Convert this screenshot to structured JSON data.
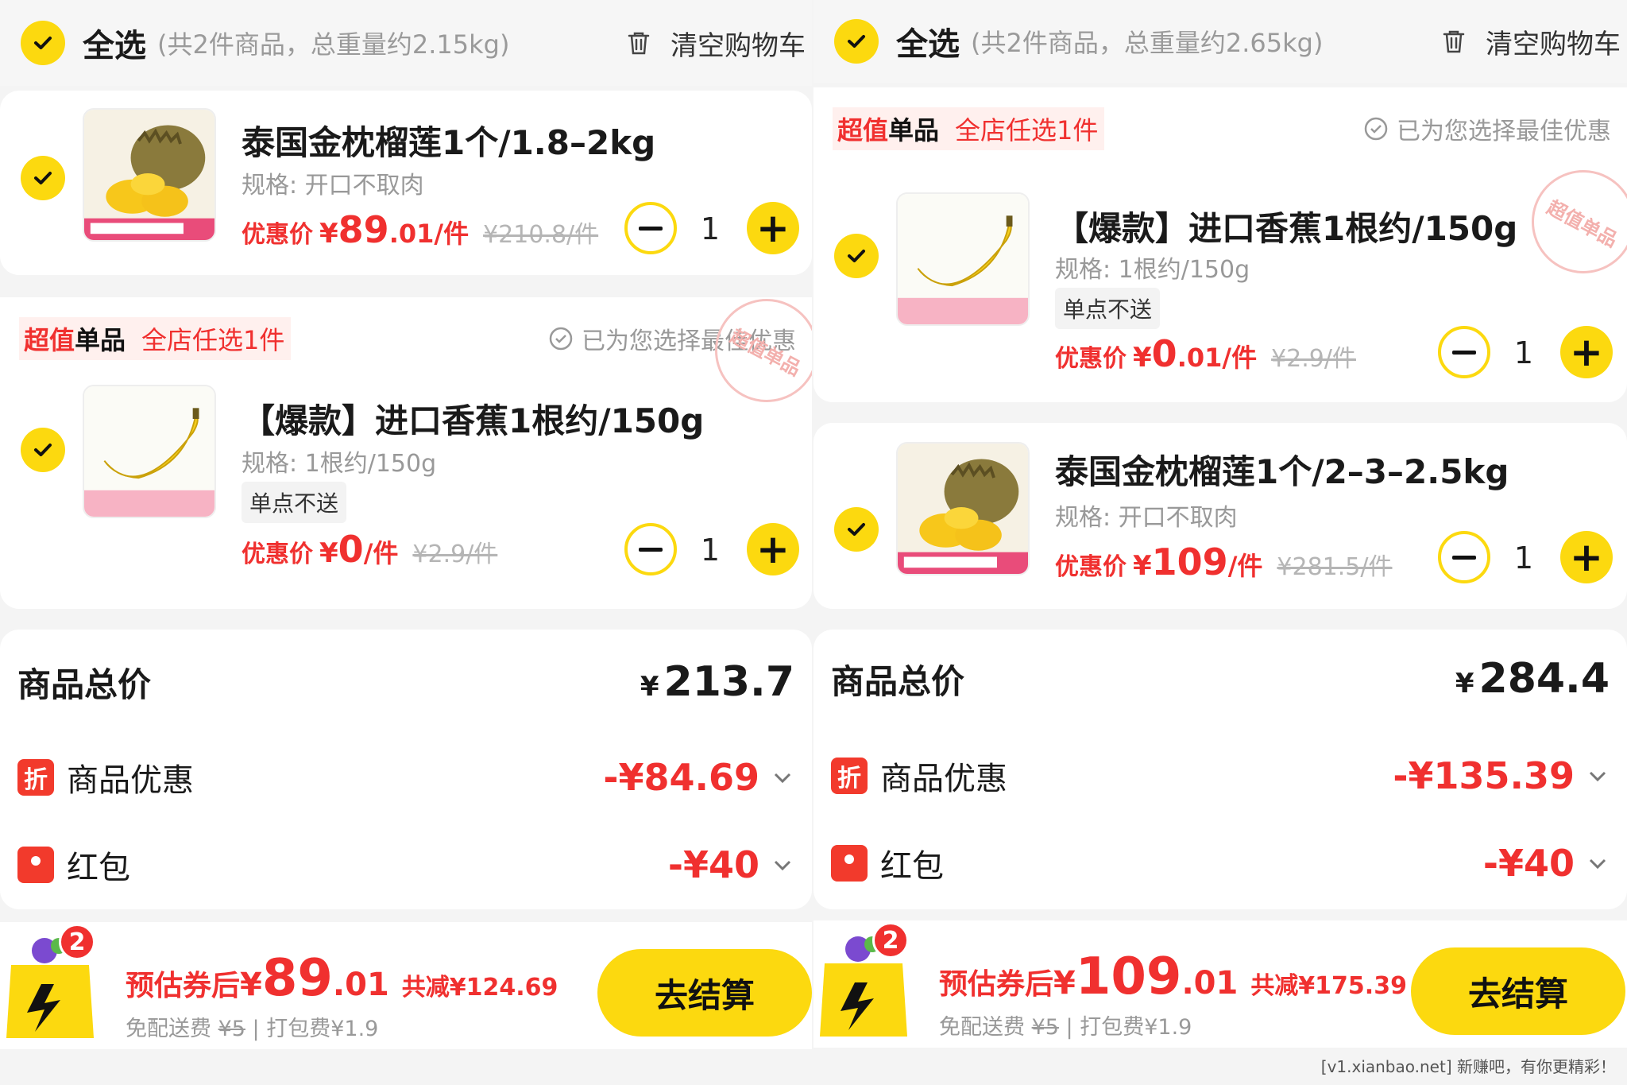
{
  "left": {
    "header": {
      "select_all": "全选",
      "meta": "(共2件商品，总重量约2.15kg)",
      "clear": "清空购物车"
    },
    "items": [
      {
        "title": "泰国金枕榴莲1个/1.8–2kg",
        "spec": "规格: 开口不取肉",
        "tag": "",
        "price_label": "优惠价",
        "yen": "¥",
        "price_int": "89",
        "price_dec": ".01",
        "unit": "/件",
        "orig": "¥210.8/件",
        "qty": "1"
      },
      {
        "title": "【爆款】进口香蕉1根约/150g",
        "spec": "规格: 1根约/150g",
        "tag": "单点不送",
        "price_label": "优惠价",
        "yen": "¥",
        "price_int": "0",
        "price_dec": "",
        "unit": "/件",
        "orig": "¥2.9/件",
        "qty": "1",
        "stamp": "超值单品"
      }
    ],
    "promo": {
      "p1a": "超值",
      "p1b": "单品",
      "p2": "全店任选1件",
      "best": "已为您选择最佳优惠"
    },
    "totals": {
      "label": "商品总价",
      "yen": "¥",
      "value": "213.7"
    },
    "discount": {
      "icon": "折",
      "label": "商品优惠",
      "value": "-¥84.69"
    },
    "redpack": {
      "label": "红包",
      "value": "-¥40"
    },
    "footer": {
      "badge": "2",
      "est_label": "预估券后",
      "yen": "¥",
      "est_int": "89",
      "est_dec": ".01",
      "saved": "共减¥124.69",
      "fee_pre": "免配送费",
      "fee_strike": "¥5",
      "fee_post": "| 打包费¥1.9",
      "pay": "去结算"
    }
  },
  "right": {
    "header": {
      "select_all": "全选",
      "meta": "(共2件商品，总重量约2.65kg)",
      "clear": "清空购物车"
    },
    "promo": {
      "p1a": "超值",
      "p1b": "单品",
      "p2": "全店任选1件",
      "best": "已为您选择最佳优惠"
    },
    "items": [
      {
        "title": "【爆款】进口香蕉1根约/150g",
        "spec": "规格: 1根约/150g",
        "tag": "单点不送",
        "price_label": "优惠价",
        "yen": "¥",
        "price_int": "0",
        "price_dec": ".01",
        "unit": "/件",
        "orig": "¥2.9/件",
        "qty": "1",
        "stamp": "超值单品"
      },
      {
        "title": "泰国金枕榴莲1个/2–3–2.5kg",
        "spec": "规格: 开口不取肉",
        "tag": "",
        "price_label": "优惠价",
        "yen": "¥",
        "price_int": "109",
        "price_dec": "",
        "unit": "/件",
        "orig": "¥281.5/件",
        "qty": "1"
      }
    ],
    "totals": {
      "label": "商品总价",
      "yen": "¥",
      "value": "284.4"
    },
    "discount": {
      "icon": "折",
      "label": "商品优惠",
      "value": "-¥135.39"
    },
    "redpack": {
      "label": "红包",
      "value": "-¥40"
    },
    "footer": {
      "badge": "2",
      "est_label": "预估券后",
      "yen": "¥",
      "est_int": "109",
      "est_dec": ".01",
      "saved": "共减¥175.39",
      "fee_pre": "免配送费",
      "fee_strike": "¥5",
      "fee_post": "| 打包费¥1.9",
      "pay": "去结算"
    }
  },
  "watermark": "[v1.xianbao.net] 新赚吧，有你更精彩！",
  "colors": {
    "accent_yellow": "#fcd90f",
    "price_red": "#f0302f"
  },
  "icons": [
    "check-icon",
    "trash-icon",
    "check-circle-icon",
    "minus-icon",
    "plus-icon",
    "discount-icon",
    "red-packet-icon",
    "chevron-down-icon",
    "shopping-bag-icon",
    "durian-image",
    "banana-image"
  ]
}
